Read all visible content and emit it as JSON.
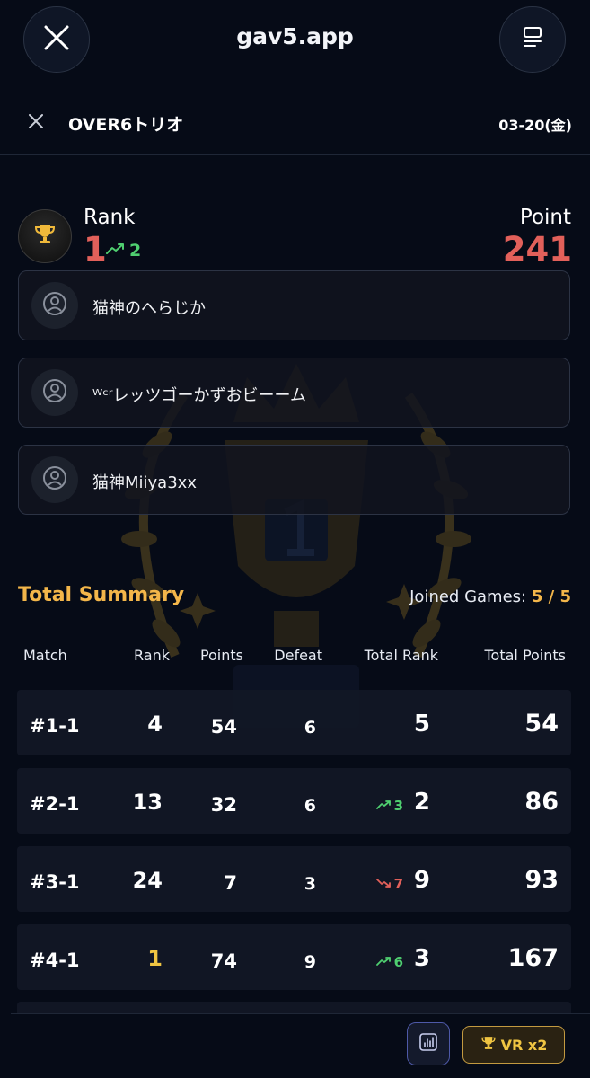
{
  "header": {
    "site_title": "gav5.app"
  },
  "subheader": {
    "team_name": "OVER6トリオ",
    "date": "03-20(金)"
  },
  "summary": {
    "rank_label": "Rank",
    "rank": "1",
    "rank_change": "2",
    "point_label": "Point",
    "points": "241"
  },
  "members": [
    {
      "name": "猫神のへらじか"
    },
    {
      "name": "ᵂᶜʳレッツゴーかずおビーーム"
    },
    {
      "name": "猫神Miiya3xx"
    }
  ],
  "total_summary": {
    "title": "Total Summary",
    "joined_label": "Joined Games:",
    "joined_value": "5 / 5"
  },
  "table": {
    "headers": {
      "match": "Match",
      "rank": "Rank",
      "points": "Points",
      "defeat": "Defeat",
      "total_rank": "Total Rank",
      "total_points": "Total Points"
    },
    "rows": [
      {
        "match": "#1-1",
        "rank": "4",
        "points": "54",
        "defeat": "6",
        "total_rank": "5",
        "total_rank_change": "",
        "total_points": "54"
      },
      {
        "match": "#2-1",
        "rank": "13",
        "points": "32",
        "defeat": "6",
        "total_rank": "2",
        "total_rank_change": "3",
        "total_points": "86"
      },
      {
        "match": "#3-1",
        "rank": "24",
        "points": "7",
        "defeat": "3",
        "total_rank": "9",
        "total_rank_change": "7",
        "total_points": "93"
      },
      {
        "match": "#4-1",
        "rank": "1",
        "points": "74",
        "defeat": "9",
        "total_rank": "3",
        "total_rank_change": "6",
        "total_points": "167"
      }
    ]
  },
  "bottom": {
    "vr_label": "VR x2"
  },
  "colors": {
    "accent_gold": "#f3b64a",
    "rank_red": "#e2605a",
    "up_green": "#4fcf70",
    "background": "#060b17"
  },
  "icons": [
    "close-icon",
    "menu-icon",
    "trophy-icon",
    "trend-up-icon",
    "trend-down-icon",
    "user-circle-icon",
    "bar-chart-icon"
  ]
}
